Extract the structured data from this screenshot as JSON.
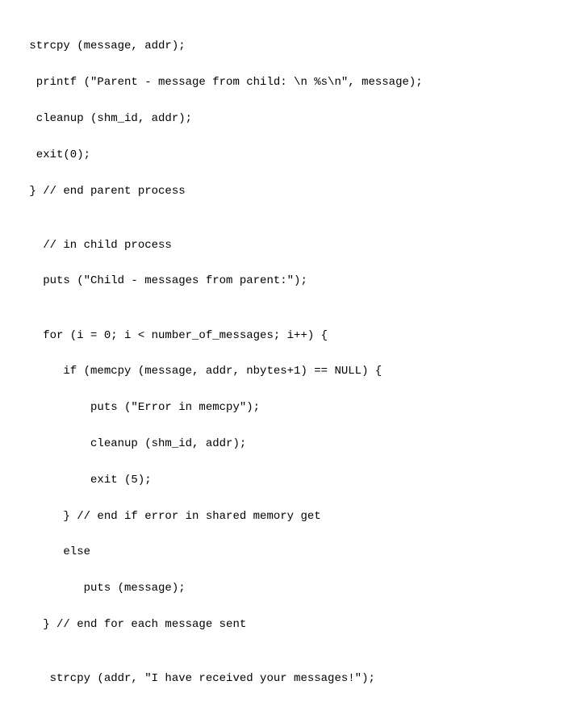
{
  "code": {
    "lines": [
      " strcpy (message, addr);",
      "  printf (\"Parent - message from child: \\n %s\\n\", message);",
      "  cleanup (shm_id, addr);",
      "  exit(0);",
      " } // end parent process",
      "",
      "   // in child process",
      "   puts (\"Child - messages from parent:\");",
      "",
      "   for (i = 0; i < number_of_messages; i++) {",
      "      if (memcpy (message, addr, nbytes+1) == NULL) {",
      "          puts (\"Error in memcpy\");",
      "          cleanup (shm_id, addr);",
      "          exit (5);",
      "      } // end if error in shared memory get",
      "      else",
      "         puts (message);",
      "   } // end for each message sent",
      "",
      "    strcpy (addr, \"I have received your messages!\");"
    ]
  }
}
